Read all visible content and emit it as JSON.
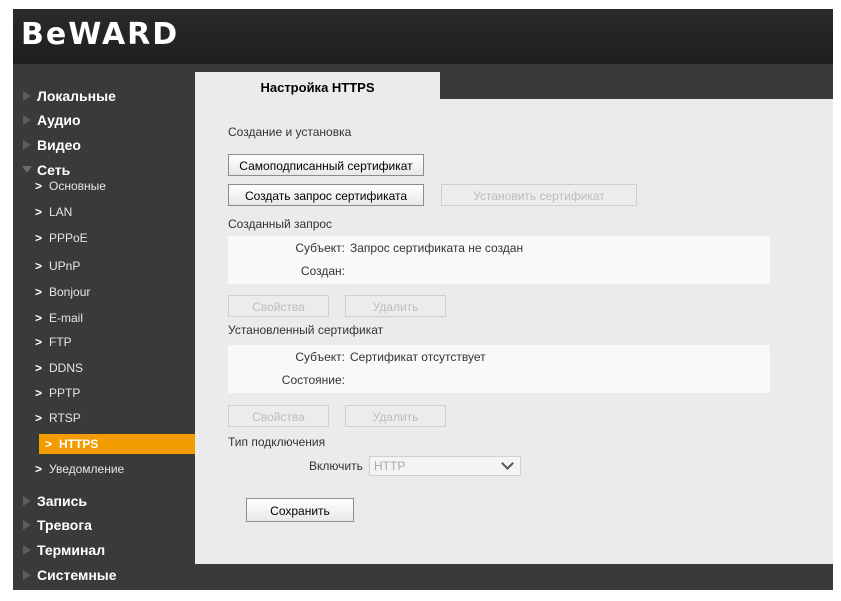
{
  "logo": "BeWARD",
  "sidebar": {
    "top_items": [
      {
        "label": "Локальные"
      },
      {
        "label": "Аудио"
      },
      {
        "label": "Видео"
      },
      {
        "label": "Сеть"
      }
    ],
    "sub_items": [
      {
        "label": "Основные"
      },
      {
        "label": "LAN"
      },
      {
        "label": "PPPoE"
      },
      {
        "label": "UPnP"
      },
      {
        "label": "Bonjour"
      },
      {
        "label": "E-mail"
      },
      {
        "label": "FTP"
      },
      {
        "label": "DDNS"
      },
      {
        "label": "PPTP"
      },
      {
        "label": "RTSP"
      },
      {
        "label": "HTTPS",
        "active": true
      },
      {
        "label": "Уведомление"
      }
    ],
    "bottom_items": [
      {
        "label": "Запись"
      },
      {
        "label": "Тревога"
      },
      {
        "label": "Терминал"
      },
      {
        "label": "Системные"
      }
    ]
  },
  "tab": {
    "label": "Настройка HTTPS"
  },
  "section_create": "Создание и установка",
  "buttons": {
    "self_signed": "Самоподписанный сертификат",
    "create_request": "Создать запрос сертификата",
    "install_cert": "Установить сертификат",
    "props1": "Свойства",
    "delete1": "Удалить",
    "props2": "Свойства",
    "delete2": "Удалить",
    "save": "Сохранить"
  },
  "request": {
    "title": "Созданный запрос",
    "subject_label": "Субъект:",
    "subject_value": "Запрос сертификата не создан",
    "created_label": "Создан:"
  },
  "installed": {
    "title": "Установленный сертификат",
    "subject_label": "Субъект:",
    "subject_value": "Сертификат отсутствует",
    "status_label": "Состояние:"
  },
  "connection": {
    "title": "Тип подключения",
    "enable_label": "Включить",
    "selected": "HTTP"
  },
  "colors": {
    "accent": "#f39c00",
    "sidebar_bg": "#3a3a3a",
    "content_bg": "#ebebeb"
  }
}
